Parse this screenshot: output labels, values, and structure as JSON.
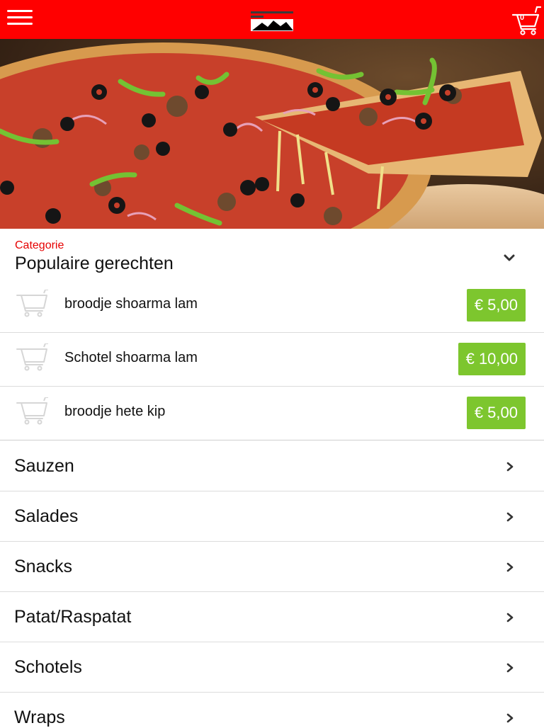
{
  "header": {
    "menu_icon": "hamburger-menu-icon",
    "cart_icon": "cart-icon",
    "cart_count": "0",
    "logo_icon": "brand-logo"
  },
  "hero": {
    "image": "pizza-photo"
  },
  "category": {
    "label": "Categorie",
    "title": "Populaire gerechten",
    "toggle_icon": "chevron-down-icon"
  },
  "items": [
    {
      "name": "broodje shoarma lam",
      "price": "€ 5,00"
    },
    {
      "name": "Schotel shoarma lam",
      "price": "€ 10,00"
    },
    {
      "name": "broodje hete kip",
      "price": "€ 5,00"
    }
  ],
  "categories": [
    {
      "label": "Sauzen"
    },
    {
      "label": "Salades"
    },
    {
      "label": "Snacks"
    },
    {
      "label": "Patat/Raspatat"
    },
    {
      "label": "Schotels"
    },
    {
      "label": "Wraps"
    }
  ],
  "colors": {
    "brand_red": "#ff0000",
    "price_green": "#7dc62e",
    "category_label": "#e60000"
  }
}
